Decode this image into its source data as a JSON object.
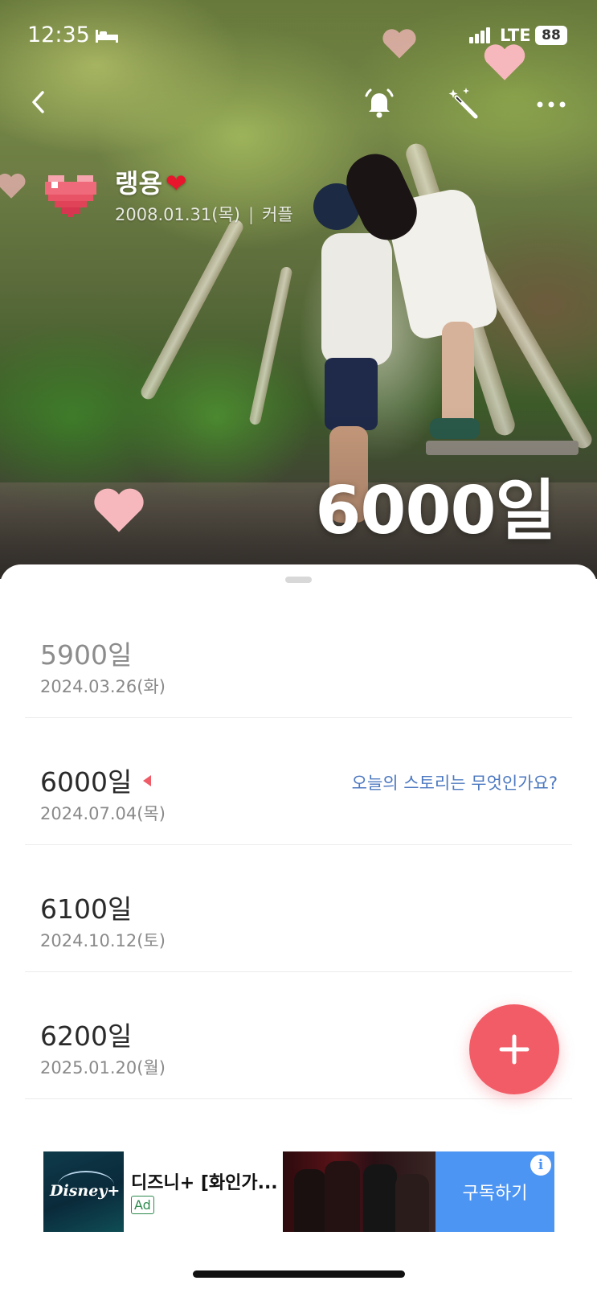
{
  "status_bar": {
    "time": "12:35",
    "network": "LTE",
    "battery": "88"
  },
  "hero": {
    "couple_name": "랭용",
    "couple_heart": "❤",
    "start_date": "2008.01.31(목)",
    "separator": "|",
    "relation": "커플",
    "highlight_day": "6000일"
  },
  "milestones": [
    {
      "day": "5900일",
      "date": "2024.03.26(화)",
      "state": "past"
    },
    {
      "day": "6000일",
      "date": "2024.07.04(목)",
      "state": "current",
      "prompt": "오늘의 스토리는 무엇인가요?"
    },
    {
      "day": "6100일",
      "date": "2024.10.12(토)",
      "state": "upcoming"
    },
    {
      "day": "6200일",
      "date": "2025.01.20(월)",
      "state": "upcoming"
    }
  ],
  "ad": {
    "title": "디즈니+ [화인가...",
    "badge": "Ad",
    "cta": "구독하기",
    "logo_text": "Disney+",
    "info_glyph": "i"
  },
  "colors": {
    "accent": "#f25c66",
    "link": "#4c78c0",
    "heart_pink": "#f7b8bd",
    "ad_cta": "#4d95f2"
  },
  "icons": [
    "back-icon",
    "bell-icon",
    "magic-wand-icon",
    "more-icon",
    "pixel-heart-icon",
    "plus-icon",
    "info-icon"
  ]
}
